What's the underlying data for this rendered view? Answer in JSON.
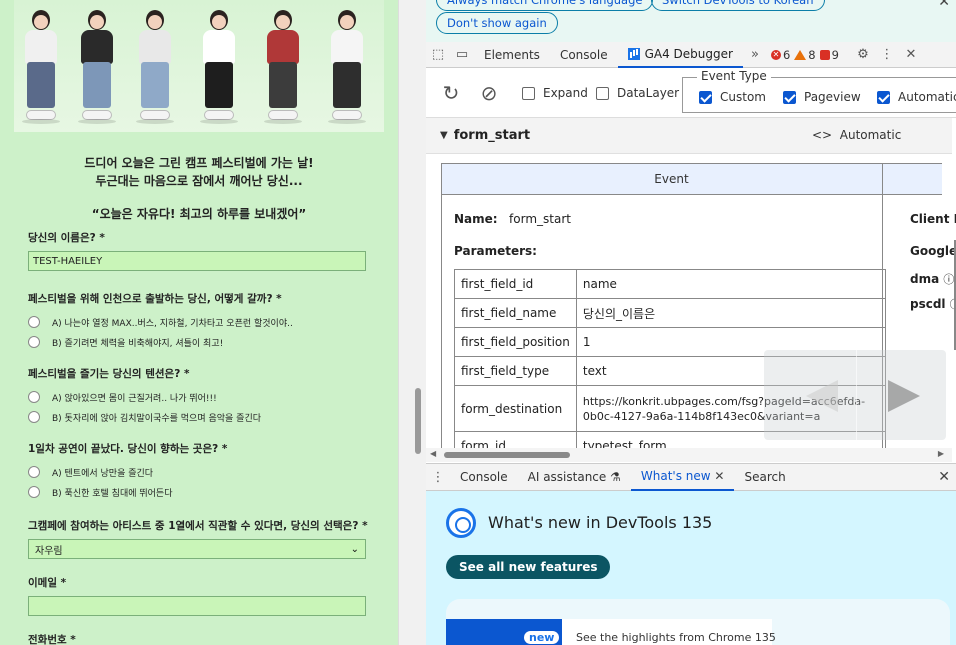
{
  "landing": {
    "intro_line1": "드디어 오늘은 그린 캠프 페스티벌에 가는 날!",
    "intro_line2": "두근대는 마음으로 잠에서 깨어난 당신...",
    "quote": "“오늘은 자유다! 최고의 하루를 보내겠어”",
    "q_name": "당신의 이름은? *",
    "name_value": "TEST-HAEILEY",
    "q_depart": "페스티벌을 위해 인천으로 출발하는 당신, 어떻게 갈까? *",
    "depart_a": "A) 나는야 열정 MAX..버스, 지하철, 기차타고 오픈런 할것이야..",
    "depart_b": "B) 즐기려면 체력을 비축해야지, 셔틀이 최고!",
    "q_tension": "페스티벌을 즐기는 당신의 텐션은? *",
    "tension_a": "A) 앉아있으면 몸이 근질거려.. 나가 뛰어!!!",
    "tension_b": "B) 돗자리에 앉아 김치말이국수를 먹으며 음악을 즐긴다",
    "q_day1": "1일차 공연이 끝났다. 당신이 향하는 곳은? *",
    "day1_a": "A) 텐트에서 낭만을 즐긴다",
    "day1_b": "B) 푹신한 호텔 침대에 뛰어든다",
    "q_artist": "그캠페에 참여하는 아티스트 중 1열에서 직관할 수 있다면, 당신의 선택은? *",
    "artist_selected": "자우림",
    "q_email": "이메일 *",
    "q_phone": "전화번호 *",
    "accent": "#c9f5b8",
    "background": "#cdf1c9"
  },
  "devtools": {
    "info_lang": "Always match Chrome's language",
    "info_switch": "Switch DevTools to Korean",
    "info_dont_show": "Don't show again",
    "tabs": [
      "Elements",
      "Console",
      "GA4 Debugger"
    ],
    "error_count": "6",
    "warning_count": "8",
    "issue_count": "9",
    "opt_expand": "Expand",
    "opt_datalayer": "DataLayer",
    "event_type_legend": "Event Type",
    "type_custom": "Custom",
    "type_pageview": "Pageview",
    "type_automatic": "Automatic",
    "event_name": "form_start",
    "event_source": "Automatic",
    "col_event": "Event",
    "name_label": "Name:",
    "name_value": "form_start",
    "params_label": "Parameters:",
    "params": [
      {
        "key": "first_field_id",
        "value": "name"
      },
      {
        "key": "first_field_name",
        "value": "당신의_이름은"
      },
      {
        "key": "first_field_position",
        "value": "1"
      },
      {
        "key": "first_field_type",
        "value": "text"
      },
      {
        "key": "form_destination",
        "value": "https://konkrit.ubpages.com/fsg?pageId=acc6efda-0b0c-4127-9a6a-114b8f143ec0&variant=a"
      },
      {
        "key": "form_id",
        "value": "typetest_form"
      }
    ],
    "side_client": "Client I",
    "side_google": "Google",
    "side_dma": "dma",
    "side_pscdl": "pscdl",
    "drawer_tabs": [
      "Console",
      "AI assistance",
      "What's new",
      "Search"
    ],
    "whatsnew_title": "What's new in DevTools 135",
    "see_all": "See all new features",
    "card_badge": "new",
    "card_text": "See the highlights from Chrome 135",
    "accent_blue": "#0b57d0"
  }
}
